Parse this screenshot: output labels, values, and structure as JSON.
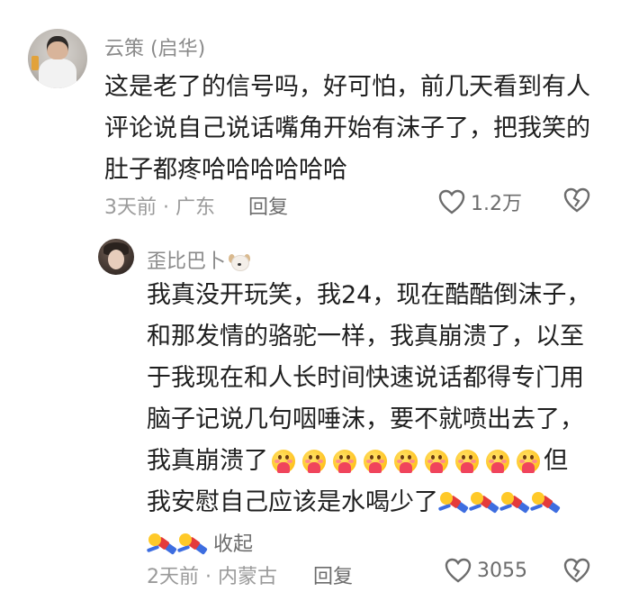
{
  "comments": [
    {
      "username": "云策 (启华)",
      "lines": [
        "这是老了的信号吗，好可怕，前几天看到有人",
        "评论说自己说话嘴角开始有沫子了，把我笑的",
        "肚子都疼哈哈哈哈哈哈"
      ],
      "meta": "3天前 · 广东",
      "reply_label": "回复",
      "likes": "1.2万"
    }
  ],
  "reply": {
    "username": "歪比巴卜",
    "username_icon": "dog-icon",
    "lines": [
      "我真没开玩笑，我24，现在酷酷倒沫子，",
      "和那发情的骆驼一样，我真崩溃了，以至",
      "于我现在和人长时间快速说话都得专门用",
      "脑子记说几句咽唾沫，要不就喷出去了，"
    ],
    "line5_prefix": "我真崩溃了",
    "line5_suffix": "但",
    "line6_prefix": "我安慰自己应该是水喝少了",
    "heart_emoji_count": 9,
    "lying_emoji_line6": 4,
    "lying_emoji_line7": 2,
    "collapse_label": "收起",
    "meta": "2天前 · 内蒙古",
    "reply_label": "回复",
    "likes": "3055"
  },
  "colors": {
    "text": "#1f1f1f",
    "secondary": "#8a8a8a",
    "icon": "#6c6c6c"
  }
}
